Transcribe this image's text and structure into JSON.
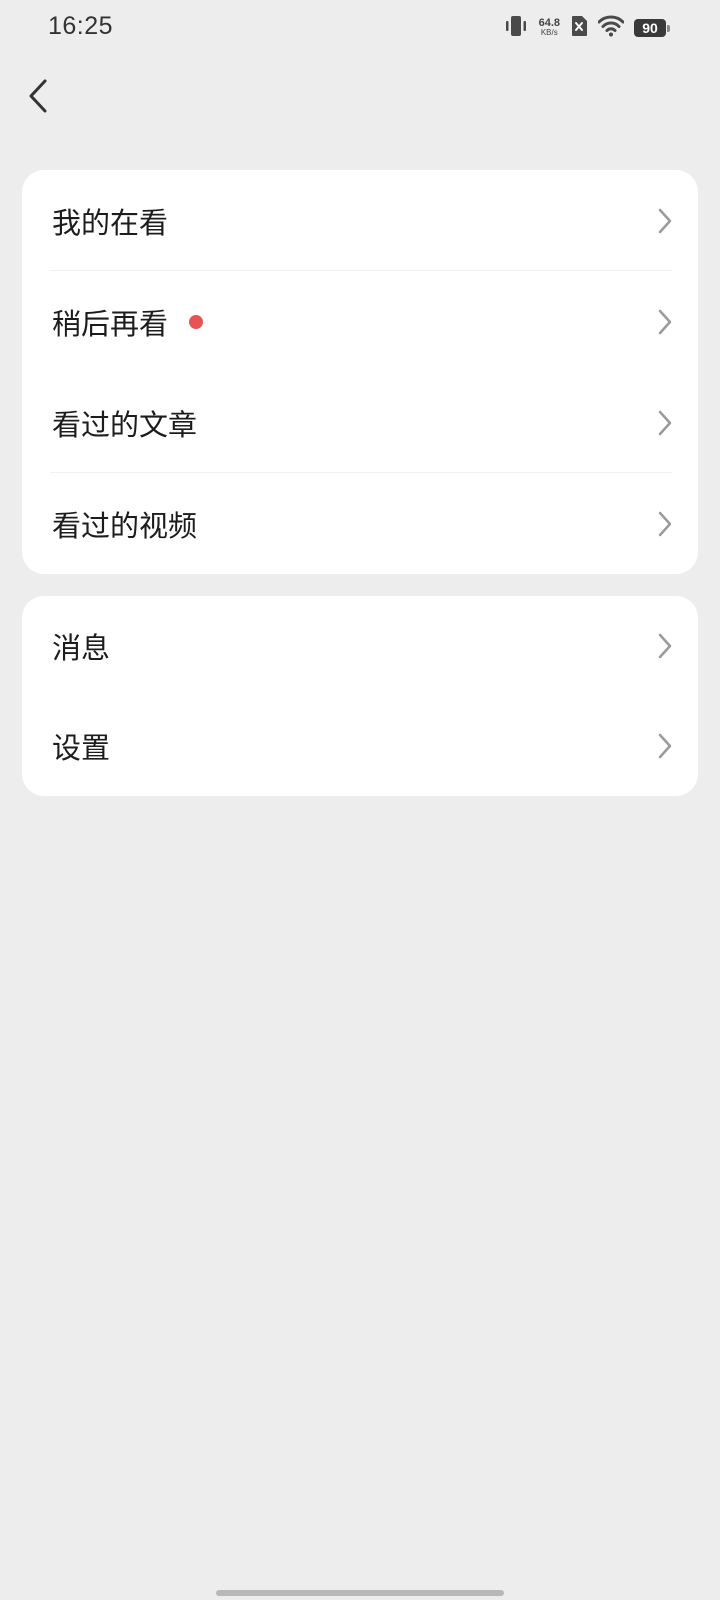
{
  "status_bar": {
    "time": "16:25",
    "net_speed_value": "64.8",
    "net_speed_unit": "KB/s",
    "battery": "90",
    "icons": [
      "vibrate-icon",
      "sim-off-icon",
      "wifi-icon",
      "battery-icon"
    ]
  },
  "header": {
    "back_icon": "chevron-left-icon"
  },
  "menu_group_1": [
    {
      "label": "我的在看",
      "badge": false
    },
    {
      "label": "稍后再看",
      "badge": true
    },
    {
      "label": "看过的文章",
      "badge": false
    },
    {
      "label": "看过的视频",
      "badge": false
    }
  ],
  "menu_group_2": [
    {
      "label": "消息"
    },
    {
      "label": "设置"
    }
  ],
  "colors": {
    "background": "#ededed",
    "card": "#ffffff",
    "badge_dot": "#e85454",
    "chevron": "#9a9a9a"
  }
}
